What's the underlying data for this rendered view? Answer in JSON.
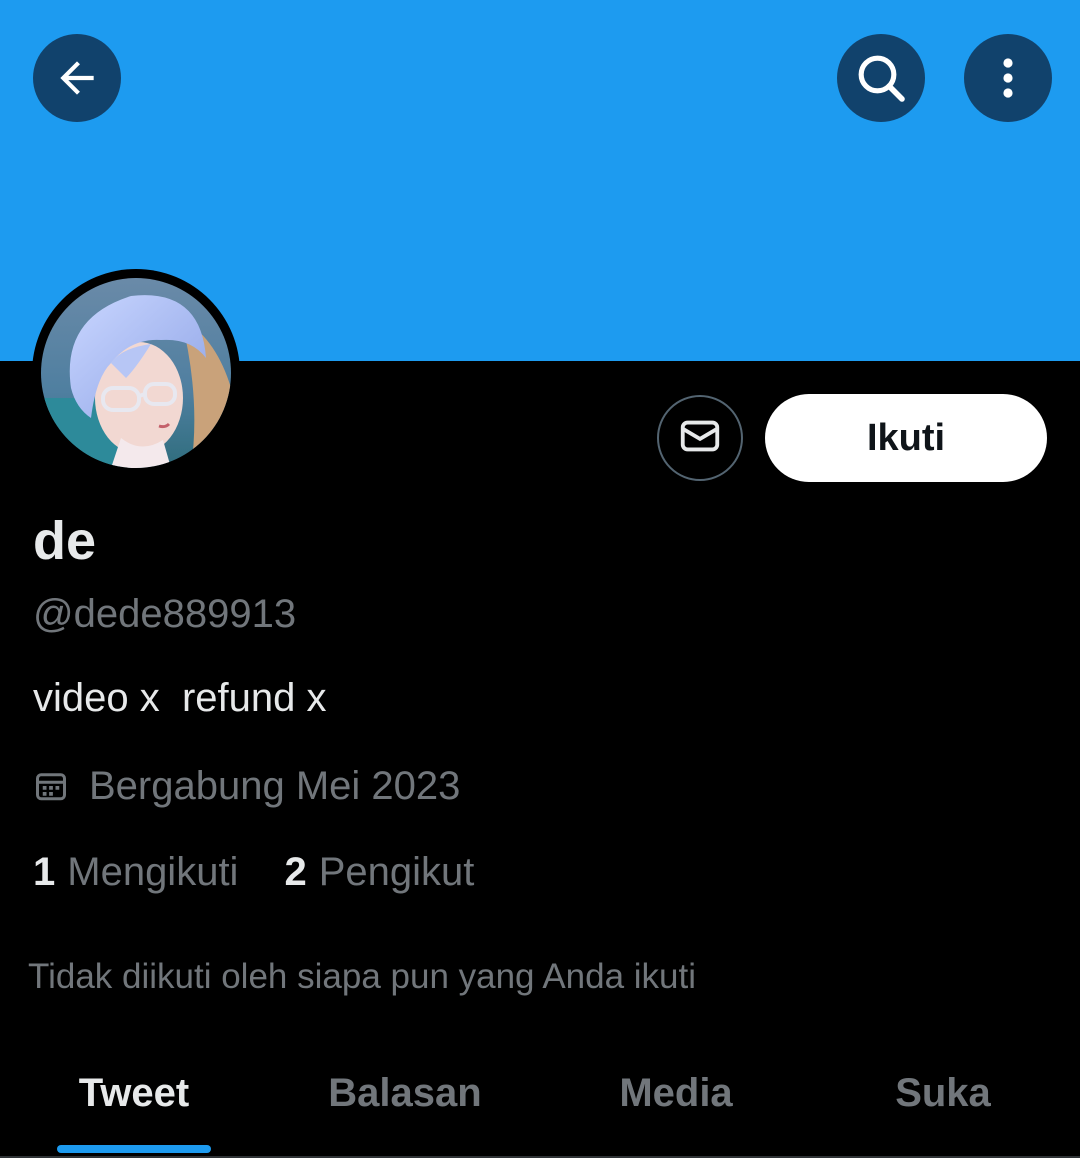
{
  "header": {
    "banner_color": "#1d9bf0",
    "back_icon": "arrow-left-icon",
    "search_icon": "search-icon",
    "more_icon": "more-vertical-icon"
  },
  "profile": {
    "display_name": "de",
    "handle": "@dede889913",
    "bio": "video x  refund x",
    "joined": "Bergabung Mei 2023",
    "following_count": "1",
    "following_label": "Mengikuti",
    "followers_count": "2",
    "followers_label": "Pengikut",
    "followed_by_note": "Tidak diikuti oleh siapa pun yang Anda ikuti"
  },
  "actions": {
    "message_icon": "mail-icon",
    "follow_label": "Ikuti"
  },
  "tabs": [
    {
      "label": "Tweet",
      "active": true
    },
    {
      "label": "Balasan",
      "active": false
    },
    {
      "label": "Media",
      "active": false
    },
    {
      "label": "Suka",
      "active": false
    }
  ],
  "colors": {
    "accent": "#1d9bf0",
    "background": "#000000",
    "primary_text": "#e7e9ea",
    "secondary_text": "#71767b"
  }
}
